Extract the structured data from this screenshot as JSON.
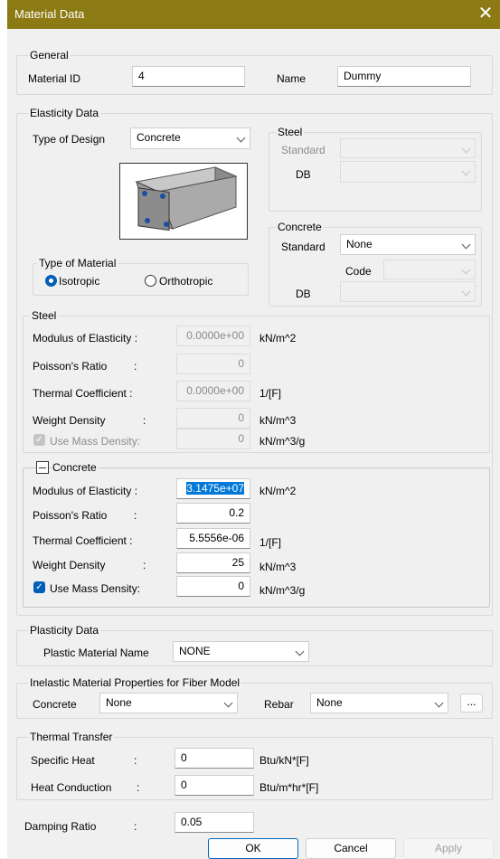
{
  "window": {
    "title": "Material Data",
    "close_glyph": "✕"
  },
  "general": {
    "group_label": "General",
    "material_id_label": "Material ID",
    "material_id_value": "4",
    "name_label": "Name",
    "name_value": "Dummy"
  },
  "elasticity": {
    "group_label": "Elasticity Data",
    "type_of_design_label": "Type of Design",
    "type_of_design_value": "Concrete",
    "steel_group": {
      "label": "Steel",
      "standard_label": "Standard",
      "db_label": "DB"
    },
    "concrete_group": {
      "label": "Concrete",
      "standard_label": "Standard",
      "standard_value": "None",
      "code_label": "Code",
      "db_label": "DB"
    },
    "type_of_material": {
      "label": "Type of Material",
      "isotropic": "Isotropic",
      "orthotropic": "Orthotropic",
      "selected": "Isotropic"
    },
    "steel_props": {
      "label": "Steel",
      "modulus_label": "Modulus of Elasticity :",
      "modulus_value": "0.0000e+00",
      "modulus_unit": "kN/m^2",
      "poisson_label": "Poisson's Ratio",
      "poisson_colon": ":",
      "poisson_value": "0",
      "thermal_label": "Thermal Coefficient  :",
      "thermal_value": "0.0000e+00",
      "thermal_unit": "1/[F]",
      "weight_label": "Weight Density",
      "weight_colon": ":",
      "weight_value": "0",
      "weight_unit": "kN/m^3",
      "mass_label": "Use Mass Density:",
      "mass_value": "0",
      "mass_unit": "kN/m^3/g"
    },
    "concrete_props": {
      "label": "Concrete",
      "modulus_label": "Modulus of Elasticity :",
      "modulus_value": "3.1475e+07",
      "modulus_unit": "kN/m^2",
      "poisson_label": "Poisson's Ratio",
      "poisson_colon": ":",
      "poisson_value": "0.2",
      "thermal_label": "Thermal Coefficient  :",
      "thermal_value": "5.5556e-06",
      "thermal_unit": "1/[F]",
      "weight_label": "Weight Density",
      "weight_colon": ":",
      "weight_value": "25",
      "weight_unit": "kN/m^3",
      "mass_label": "Use Mass Density:",
      "mass_value": "0",
      "mass_unit": "kN/m^3/g"
    }
  },
  "plasticity": {
    "group_label": "Plasticity Data",
    "plastic_name_label": "Plastic Material Name",
    "plastic_name_value": "NONE"
  },
  "inelastic": {
    "group_label": "Inelastic Material Properties for Fiber Model",
    "concrete_label": "Concrete",
    "concrete_value": "None",
    "rebar_label": "Rebar",
    "rebar_value": "None",
    "more_label": "..."
  },
  "thermal": {
    "group_label": "Thermal Transfer",
    "specific_heat_label": "Specific Heat",
    "specific_heat_colon": ":",
    "specific_heat_value": "0",
    "specific_heat_unit": "Btu/kN*[F]",
    "heat_conduction_label": "Heat Conduction",
    "heat_conduction_colon": ":",
    "heat_conduction_value": "0",
    "heat_conduction_unit": "Btu/m*hr*[F]"
  },
  "damping": {
    "label": "Damping Ratio",
    "colon": ":",
    "value": "0.05"
  },
  "buttons": {
    "ok": "OK",
    "cancel": "Cancel",
    "apply": "Apply"
  }
}
